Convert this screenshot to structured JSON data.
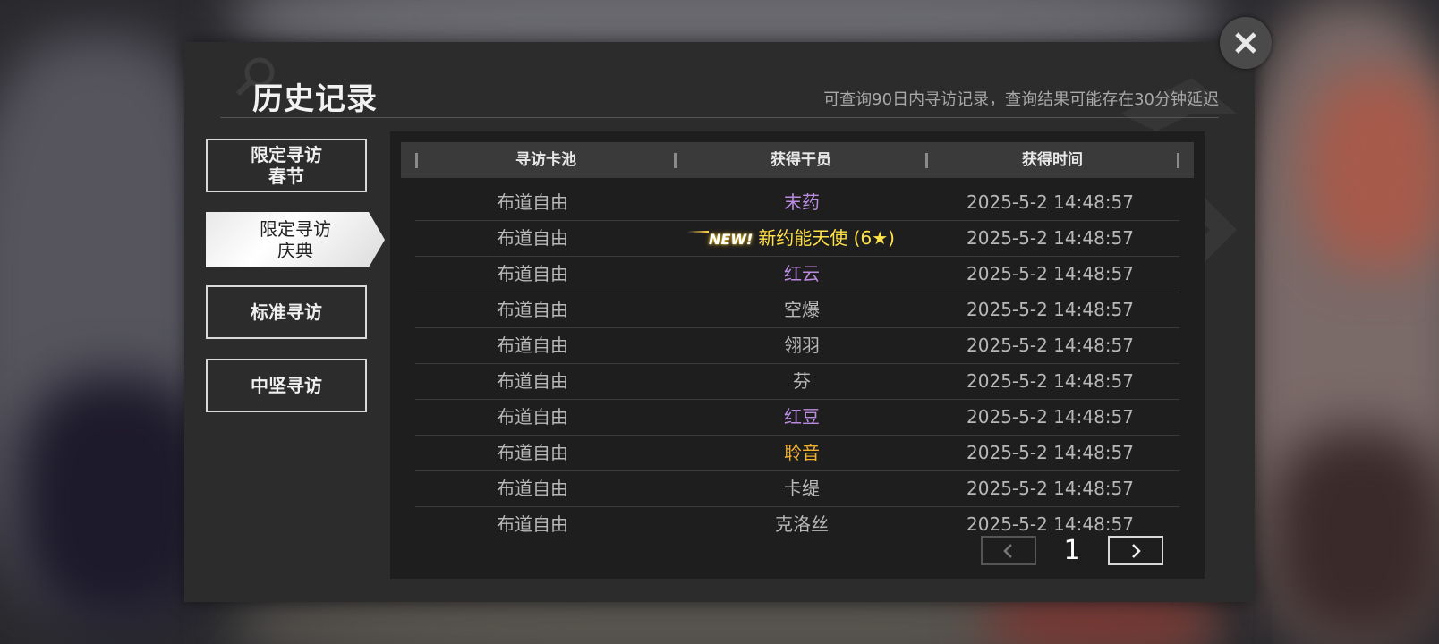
{
  "header": {
    "title": "历史记录",
    "hint": "可查询90日内寻访记录，查询结果可能存在30分钟延迟"
  },
  "tabs": [
    {
      "lines": [
        "限定寻访",
        "春节"
      ],
      "active": false
    },
    {
      "lines": [
        "限定寻访",
        "庆典"
      ],
      "active": true
    },
    {
      "lines": [
        "标准寻访"
      ],
      "active": false
    },
    {
      "lines": [
        "中坚寻访"
      ],
      "active": false
    }
  ],
  "table": {
    "columns": [
      "寻访卡池",
      "获得干员",
      "获得时间"
    ],
    "rows": [
      {
        "pool": "布道自由",
        "operator": "末药",
        "time": "2025-5-2 14:48:57",
        "rarity_color": "#b98ce0",
        "new": false
      },
      {
        "pool": "布道自由",
        "operator": "新约能天使 (6★)",
        "time": "2025-5-2 14:48:57",
        "rarity_color": "#ffe14a",
        "new": true,
        "new_label": "NEW!"
      },
      {
        "pool": "布道自由",
        "operator": "红云",
        "time": "2025-5-2 14:48:57",
        "rarity_color": "#b98ce0",
        "new": false
      },
      {
        "pool": "布道自由",
        "operator": "空爆",
        "time": "2025-5-2 14:48:57",
        "rarity_color": "#b8b8b8",
        "new": false
      },
      {
        "pool": "布道自由",
        "operator": "翎羽",
        "time": "2025-5-2 14:48:57",
        "rarity_color": "#b8b8b8",
        "new": false
      },
      {
        "pool": "布道自由",
        "operator": "芬",
        "time": "2025-5-2 14:48:57",
        "rarity_color": "#b8b8b8",
        "new": false
      },
      {
        "pool": "布道自由",
        "operator": "红豆",
        "time": "2025-5-2 14:48:57",
        "rarity_color": "#b98ce0",
        "new": false
      },
      {
        "pool": "布道自由",
        "operator": "聆音",
        "time": "2025-5-2 14:48:57",
        "rarity_color": "#f0b032",
        "new": false
      },
      {
        "pool": "布道自由",
        "operator": "卡缇",
        "time": "2025-5-2 14:48:57",
        "rarity_color": "#b8b8b8",
        "new": false
      },
      {
        "pool": "布道自由",
        "operator": "克洛丝",
        "time": "2025-5-2 14:48:57",
        "rarity_color": "#b8b8b8",
        "new": false
      }
    ]
  },
  "pager": {
    "page": "1",
    "prev_icon": "chevron-left-icon",
    "next_icon": "chevron-right-icon"
  },
  "close": {
    "icon": "close-icon"
  }
}
